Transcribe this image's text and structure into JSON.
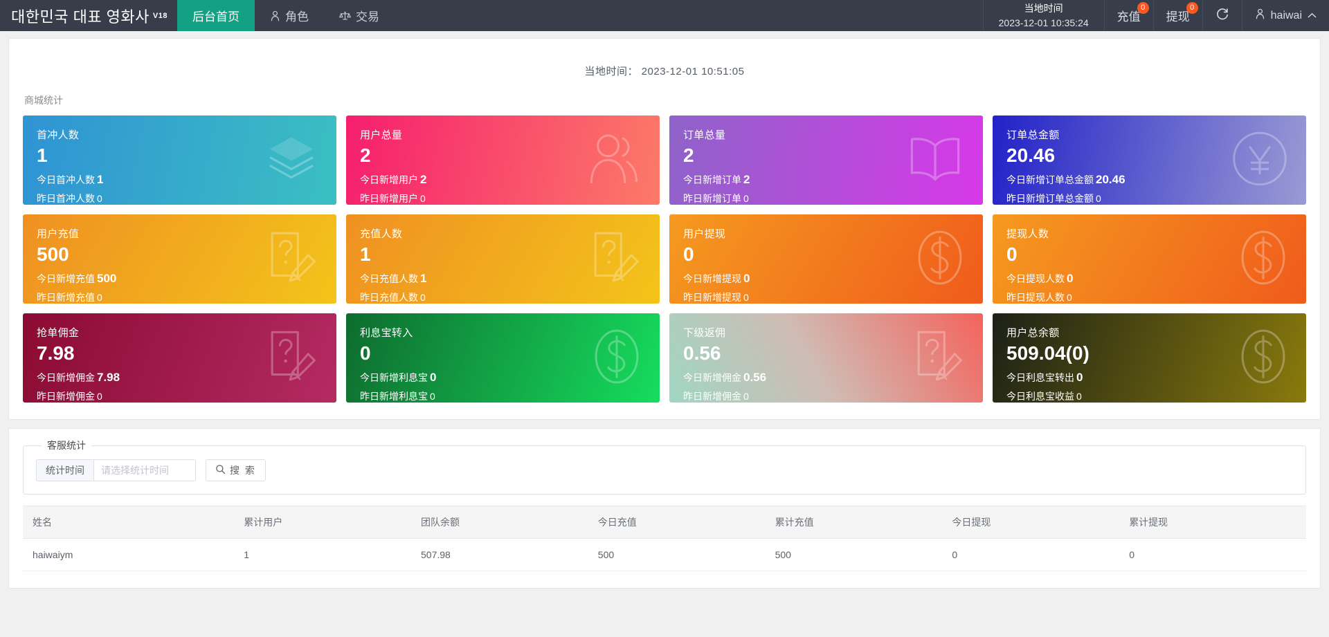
{
  "header": {
    "brand": "대한민국 대표 영화사",
    "brand_version": "V18",
    "nav": [
      {
        "label": "后台首页",
        "icon": "",
        "active": true
      },
      {
        "label": "角色",
        "icon": "user-icon",
        "active": false
      },
      {
        "label": "交易",
        "icon": "balance-scale-icon",
        "active": false
      }
    ],
    "local_time_label": "当地时间",
    "local_time_value": "2023-12-01 10:35:24",
    "recharge_label": "充值",
    "recharge_badge": "0",
    "withdraw_label": "提现",
    "withdraw_badge": "0",
    "refresh_icon": "refresh-icon",
    "user_name": "haiwai",
    "user_caret": "chevron-up-icon"
  },
  "page": {
    "time_text": "当地时间： 2023-12-01 10:51:05",
    "section_title": "商城统计"
  },
  "cards": [
    {
      "title": "首冲人数",
      "value": "1",
      "today_label": "今日首冲人数",
      "today_value": "1",
      "yesterday_label": "昨日首冲人数",
      "yesterday_value": "0",
      "icon": "layers-icon",
      "theme": "g-blue"
    },
    {
      "title": "用户总量",
      "value": "2",
      "today_label": "今日新增用户",
      "today_value": "2",
      "yesterday_label": "昨日新增用户",
      "yesterday_value": "0",
      "icon": "users-icon",
      "theme": "g-pink"
    },
    {
      "title": "订单总量",
      "value": "2",
      "today_label": "今日新增订单",
      "today_value": "2",
      "yesterday_label": "昨日新增订单",
      "yesterday_value": "0",
      "icon": "book-icon",
      "theme": "g-purple"
    },
    {
      "title": "订单总金额",
      "value": "20.46",
      "today_label": "今日新增订单总金额",
      "today_value": "20.46",
      "yesterday_label": "昨日新增订单总金额",
      "yesterday_value": "0",
      "icon": "yuan-circle-icon",
      "theme": "g-indigo"
    },
    {
      "title": "用户充值",
      "value": "500",
      "today_label": "今日新增充值",
      "today_value": "500",
      "yesterday_label": "昨日新增充值",
      "yesterday_value": "0",
      "icon": "edit-note-icon",
      "theme": "g-orange1"
    },
    {
      "title": "充值人数",
      "value": "1",
      "today_label": "今日充值人数",
      "today_value": "1",
      "yesterday_label": "昨日充值人数",
      "yesterday_value": "0",
      "icon": "edit-note-icon",
      "theme": "g-orange1"
    },
    {
      "title": "用户提现",
      "value": "0",
      "today_label": "今日新增提现",
      "today_value": "0",
      "yesterday_label": "昨日新增提现",
      "yesterday_value": "0",
      "icon": "dollar-oval-icon",
      "theme": "g-orange2"
    },
    {
      "title": "提现人数",
      "value": "0",
      "today_label": "今日提现人数",
      "today_value": "0",
      "yesterday_label": "昨日提现人数",
      "yesterday_value": "0",
      "icon": "dollar-oval-icon",
      "theme": "g-orange2"
    },
    {
      "title": "抢单佣金",
      "value": "7.98",
      "today_label": "今日新增佣金",
      "today_value": "7.98",
      "yesterday_label": "昨日新增佣金",
      "yesterday_value": "0",
      "icon": "edit-note-icon",
      "theme": "g-maroon"
    },
    {
      "title": "利息宝转入",
      "value": "0",
      "today_label": "今日新增利息宝",
      "today_value": "0",
      "yesterday_label": "昨日新增利息宝",
      "yesterday_value": "0",
      "icon": "dollar-oval-icon",
      "theme": "g-green"
    },
    {
      "title": "下级返佣",
      "value": "0.56",
      "today_label": "今日新增佣金",
      "today_value": "0.56",
      "yesterday_label": "昨日新增佣金",
      "yesterday_value": "0",
      "icon": "edit-note-icon",
      "theme": "g-fade"
    },
    {
      "title": "用户总余额",
      "value": "509.04(0)",
      "today_label": "今日利息宝转出",
      "today_value": "0",
      "yesterday_label": "今日利息宝收益",
      "yesterday_value": "0",
      "icon": "dollar-oval-icon",
      "theme": "g-olive"
    }
  ],
  "service_panel": {
    "legend": "客服统计",
    "time_label": "统计时间",
    "time_placeholder": "请选择统计时间",
    "search_button": "搜 索",
    "search_icon": "search-icon",
    "table": {
      "columns": [
        "姓名",
        "累计用户",
        "团队余额",
        "今日充值",
        "累计充值",
        "今日提现",
        "累计提现"
      ],
      "rows": [
        [
          "haiwaiym",
          "1",
          "507.98",
          "500",
          "500",
          "0",
          "0"
        ]
      ]
    }
  },
  "colors": {
    "header_bg": "#373d49",
    "accent_green": "#12a182",
    "badge_orange": "#ff5722",
    "page_bg": "#f0f0f0"
  }
}
